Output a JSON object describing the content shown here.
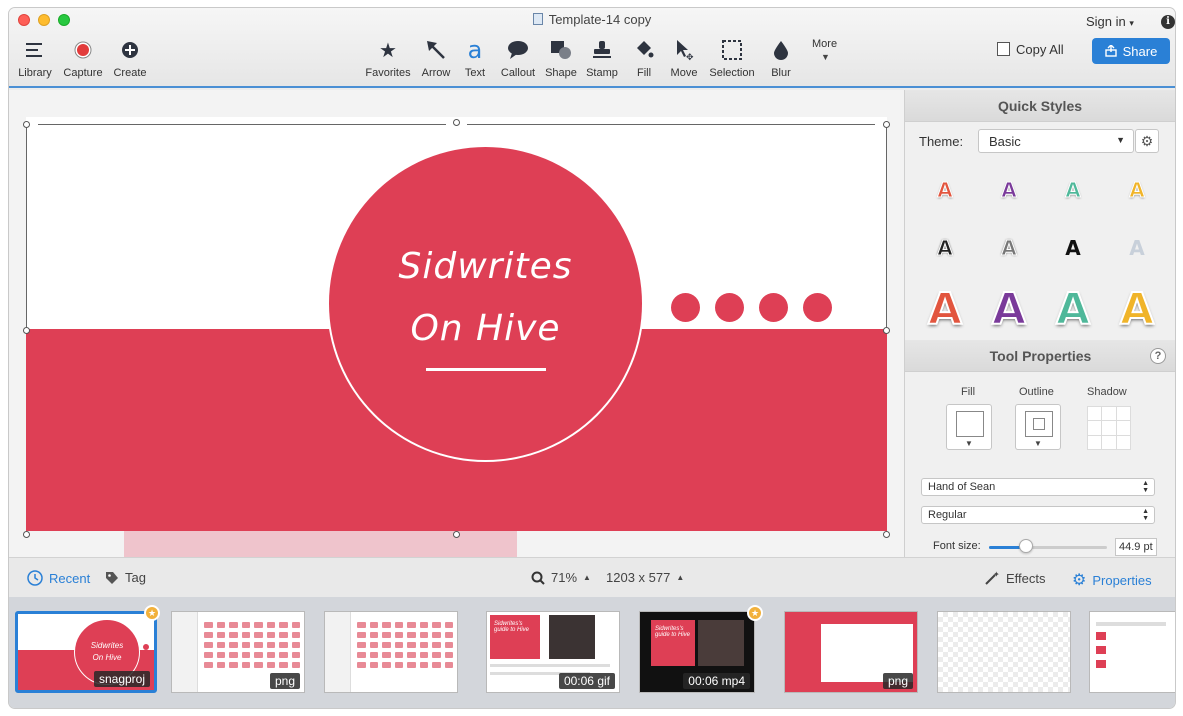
{
  "window": {
    "title": "Template-14 copy",
    "signin": "Sign in",
    "info": "i"
  },
  "toolbar": {
    "library": "Library",
    "capture": "Capture",
    "create": "Create",
    "tools": [
      {
        "label": "Favorites",
        "icon": "star-icon"
      },
      {
        "label": "Arrow",
        "icon": "arrow-icon"
      },
      {
        "label": "Text",
        "icon": "text-icon"
      },
      {
        "label": "Callout",
        "icon": "callout-icon"
      },
      {
        "label": "Shape",
        "icon": "shape-icon"
      },
      {
        "label": "Stamp",
        "icon": "stamp-icon"
      },
      {
        "label": "Fill",
        "icon": "fill-icon"
      },
      {
        "label": "Move",
        "icon": "move-icon"
      },
      {
        "label": "Selection",
        "icon": "selection-icon"
      },
      {
        "label": "Blur",
        "icon": "blur-icon"
      }
    ],
    "more": "More",
    "copy_all": "Copy All",
    "share": "Share"
  },
  "canvas": {
    "line1": "Sidwrites",
    "line2": "On Hive",
    "accent": "#de3f55",
    "dots": 4
  },
  "quick_styles": {
    "title": "Quick Styles",
    "theme_label": "Theme:",
    "theme_value": "Basic",
    "glyph": "A"
  },
  "tool_properties": {
    "title": "Tool Properties",
    "help": "?",
    "fill_label": "Fill",
    "outline_label": "Outline",
    "shadow_label": "Shadow",
    "font_family": "Hand of Sean",
    "font_style": "Regular",
    "font_size_label": "Font size:",
    "font_size_value": "44.9 pt",
    "font_size_fraction": 0.31
  },
  "statusbar": {
    "recent": "Recent",
    "tag": "Tag",
    "zoom": "71%",
    "dimensions": "1203 x 577",
    "effects": "Effects",
    "properties": "Properties"
  },
  "tray": {
    "items": [
      {
        "badge": "snagproj",
        "line1": "Sidwrites",
        "line2": "On Hive"
      },
      {
        "badge": "png"
      },
      {
        "badge": ""
      },
      {
        "badge": "00:06 gif",
        "caption": "Sidwrites's guide to Hive"
      },
      {
        "badge": "00:06 mp4",
        "caption": "Sidwrites's guide to Hive"
      },
      {
        "badge": "png"
      },
      {
        "badge": ""
      },
      {
        "badge": ""
      }
    ]
  }
}
